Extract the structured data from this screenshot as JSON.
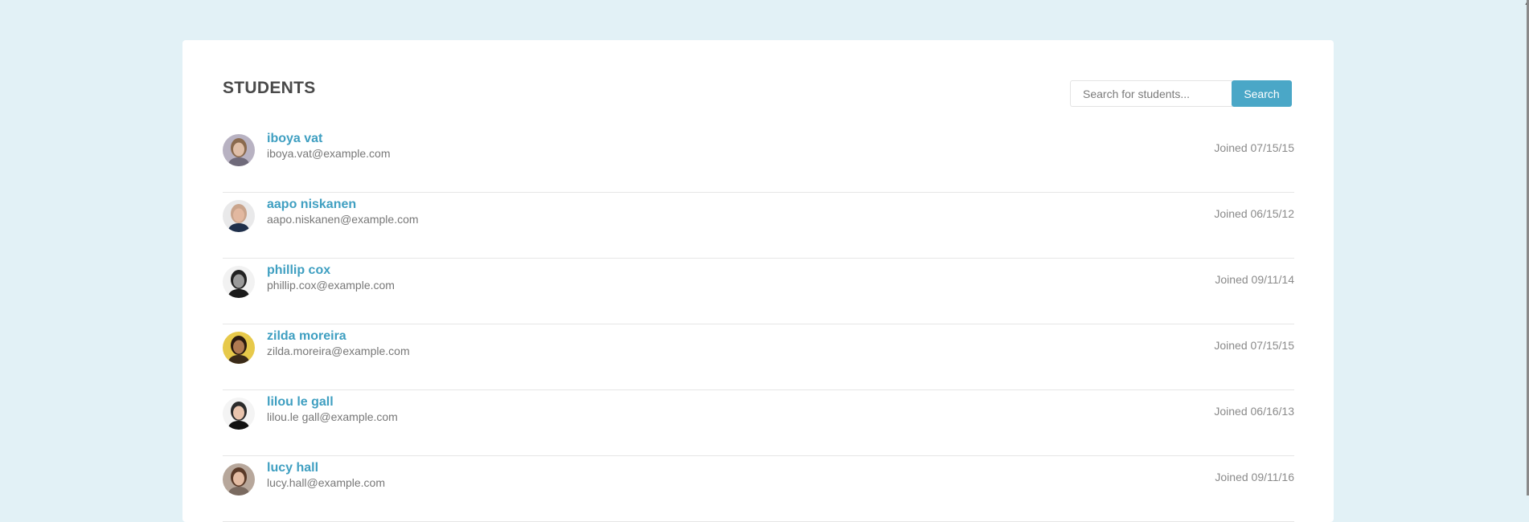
{
  "page": {
    "title": "STUDENTS",
    "colors": {
      "background": "#e2f1f6",
      "card": "#ffffff",
      "accent": "#4aa7c7",
      "name": "#3f9fc1",
      "email": "#777777",
      "joined": "#8a8a8a"
    }
  },
  "search": {
    "placeholder": "Search for students...",
    "value": "",
    "button_label": "Search"
  },
  "students": [
    {
      "name": "iboya vat",
      "email": "iboya.vat@example.com",
      "joined": "Joined 07/15/15",
      "avatar_icon": "avatar-woman-blonde",
      "avatar_colors": {
        "bg": "#b8b2c2",
        "hair": "#8a6a4e",
        "skin": "#e0bfa8",
        "shirt": "#6f6a7a"
      }
    },
    {
      "name": "aapo niskanen",
      "email": "aapo.niskanen@example.com",
      "joined": "Joined 06/15/12",
      "avatar_icon": "avatar-man-bald",
      "avatar_colors": {
        "bg": "#e9e9ea",
        "hair": "#c9a48c",
        "skin": "#e2b8a0",
        "shirt": "#1f2f4a"
      }
    },
    {
      "name": "phillip cox",
      "email": "phillip.cox@example.com",
      "joined": "Joined 09/11/14",
      "avatar_icon": "avatar-man-glasses",
      "avatar_colors": {
        "bg": "#f2f2f2",
        "hair": "#222222",
        "skin": "#9a9a9a",
        "shirt": "#1a1a1a"
      }
    },
    {
      "name": "zilda moreira",
      "email": "zilda.moreira@example.com",
      "joined": "Joined 07/15/15",
      "avatar_icon": "avatar-woman-dark-hair",
      "avatar_colors": {
        "bg": "#e7c94a",
        "hair": "#2a1a10",
        "skin": "#b07a52",
        "shirt": "#3a2a18"
      }
    },
    {
      "name": "lilou le gall",
      "email": "lilou.le gall@example.com",
      "joined": "Joined 06/16/13",
      "avatar_icon": "avatar-woman-short-hair",
      "avatar_colors": {
        "bg": "#f4f4f4",
        "hair": "#2b2b2b",
        "skin": "#e9c4ad",
        "shirt": "#111111"
      }
    },
    {
      "name": "lucy hall",
      "email": "lucy.hall@example.com",
      "joined": "Joined 09/11/16",
      "avatar_icon": "avatar-woman-brown-hair",
      "avatar_colors": {
        "bg": "#b7a79b",
        "hair": "#5a3a28",
        "skin": "#e4bca3",
        "shirt": "#7a6a60"
      }
    }
  ]
}
